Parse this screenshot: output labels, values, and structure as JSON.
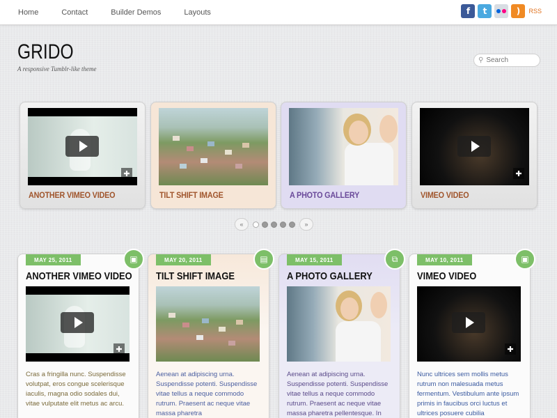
{
  "nav": {
    "items": [
      "Home",
      "Contact",
      "Builder Demos",
      "Layouts"
    ],
    "social": {
      "rss_label": "RSS"
    }
  },
  "branding": {
    "logo": "GRIDO",
    "tagline": "A responsive Tumblr-like theme"
  },
  "search": {
    "placeholder": "Search"
  },
  "featured": [
    {
      "title": "ANOTHER VIMEO VIDEO",
      "type": "video",
      "title_color": "#a0552c"
    },
    {
      "title": "TILT SHIFT IMAGE",
      "type": "image",
      "title_color": "#a0552c"
    },
    {
      "title": "A PHOTO GALLERY",
      "type": "gallery",
      "title_color": "#6a4a9a"
    },
    {
      "title": "VIMEO VIDEO",
      "type": "video",
      "title_color": "#a0552c"
    }
  ],
  "pager": {
    "prev": "«",
    "next": "»",
    "pages": 5,
    "active_index": 0
  },
  "posts": [
    {
      "date": "MAY 25, 2011",
      "title": "ANOTHER VIMEO VIDEO",
      "icon": "video-icon",
      "excerpt": "Cras a fringilla nunc. Suspendisse volutpat, eros congue scelerisque iaculis, magna odio sodales dui, vitae vulputate elit metus ac arcu."
    },
    {
      "date": "MAY 20, 2011",
      "title": "TILT SHIFT IMAGE",
      "icon": "image-icon",
      "excerpt": "Aenean at adipiscing urna. Suspendisse potenti. Suspendisse vitae tellus a neque commodo rutrum. Praesent ac neque vitae massa pharetra"
    },
    {
      "date": "MAY 15, 2011",
      "title": "A PHOTO GALLERY",
      "icon": "gallery-icon",
      "excerpt": "Aenean at adipiscing urna. Suspendisse potenti. Suspendisse vitae tellus a neque commodo rutrum. Praesent ac neque vitae massa pharetra pellentesque. In gravida arcu ut"
    },
    {
      "date": "MAY 10, 2011",
      "title": "VIMEO VIDEO",
      "icon": "video-icon",
      "excerpt": "Nunc ultrices sem mollis metus rutrum non malesuada metus fermentum. Vestibulum ante ipsum primis in faucibus orci luctus et ultrices posuere cubilia"
    }
  ],
  "colors": {
    "accent_green": "#7dbf68",
    "title_brown": "#a0552c",
    "title_violet": "#6a4a9a"
  }
}
